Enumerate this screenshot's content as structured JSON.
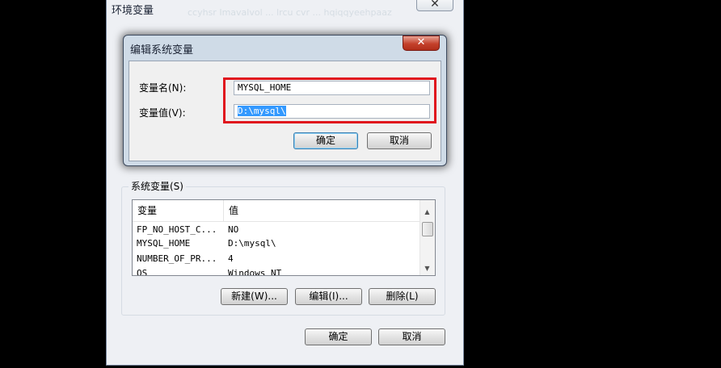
{
  "outer": {
    "title": "环境变量",
    "ghost_text": "ccyhsr Imavalvol ... lrcu cvr ... hqiqqyeehpaaz",
    "close_glyph": "✕",
    "ok_label": "确定",
    "cancel_label": "取消"
  },
  "edit_dialog": {
    "title": "编辑系统变量",
    "close_glyph": "✕",
    "name_label": "变量名(N):",
    "value_label": "变量值(V):",
    "name_value": "MYSQL_HOME",
    "value_value": "D:\\mysql\\",
    "ok_label": "确定",
    "cancel_label": "取消",
    "highlight_color": "#e0141d"
  },
  "system_vars": {
    "group_label": "系统变量(S)",
    "columns": [
      "变量",
      "值"
    ],
    "rows": [
      {
        "name": "FP_NO_HOST_C...",
        "value": "NO"
      },
      {
        "name": "MYSQL_HOME",
        "value": "D:\\mysql\\"
      },
      {
        "name": "NUMBER_OF_PR...",
        "value": "4"
      },
      {
        "name": "OS",
        "value": "Windows_NT"
      }
    ],
    "new_label": "新建(W)...",
    "edit_label": "编辑(I)...",
    "delete_label": "删除(L)",
    "scroll_up_glyph": "▲",
    "scroll_down_glyph": "▼"
  }
}
